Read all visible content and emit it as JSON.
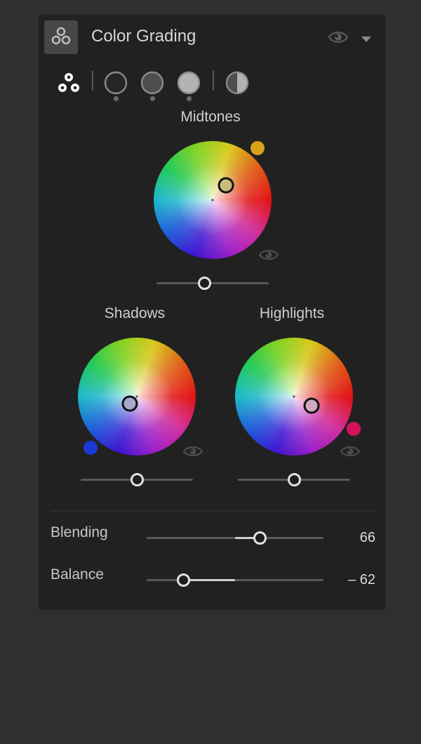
{
  "header": {
    "title": "Color Grading",
    "icon": "three-circles-icon"
  },
  "modes": [
    {
      "name": "all-wheels",
      "icon": "three-circles-icon"
    },
    {
      "name": "shadows",
      "icon": "shadow-circle-icon"
    },
    {
      "name": "midtones",
      "icon": "midtone-circle-icon"
    },
    {
      "name": "highlights",
      "icon": "highlight-circle-icon"
    },
    {
      "name": "global",
      "icon": "half-circle-icon"
    }
  ],
  "wheels": {
    "midtones": {
      "label": "Midtones",
      "swatch": "#d4a21c",
      "luminance_fraction": 0.43
    },
    "shadows": {
      "label": "Shadows",
      "swatch": "#1a3ad6",
      "luminance_fraction": 0.5
    },
    "highlights": {
      "label": "Highlights",
      "swatch": "#d4125a",
      "luminance_fraction": 0.5
    }
  },
  "adjustments": {
    "blending": {
      "label": "Blending",
      "value": "66",
      "fraction": 0.64
    },
    "balance": {
      "label": "Balance",
      "value": "– 62",
      "fraction": 0.21
    }
  },
  "colors": {
    "panel": "#212121",
    "background": "#2f2f2f",
    "text": "#d6d6d6"
  }
}
